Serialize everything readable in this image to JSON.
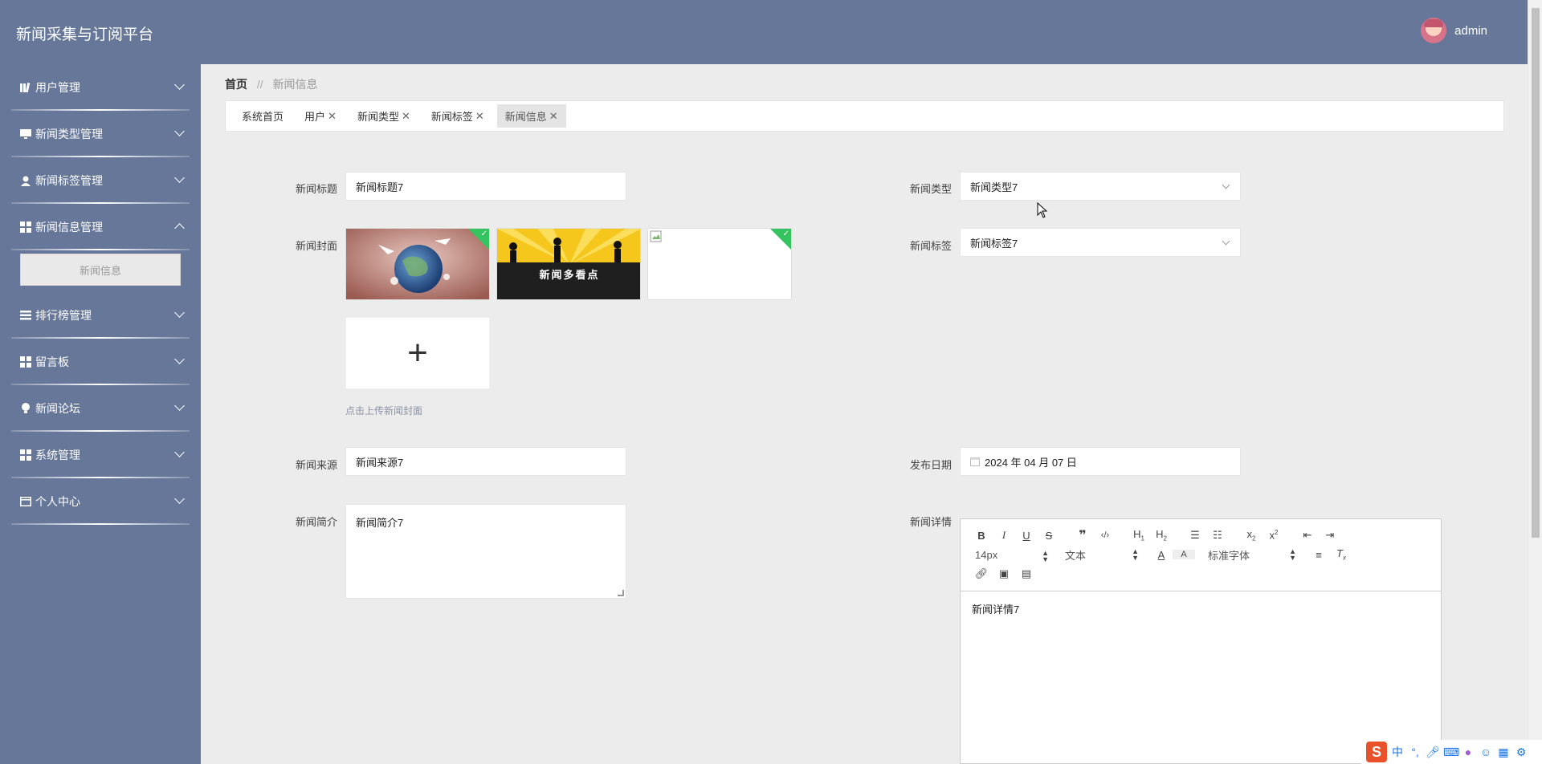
{
  "header": {
    "app_title": "新闻采集与订阅平台",
    "username": "admin"
  },
  "sidebar": {
    "items": [
      {
        "label": "用户管理",
        "icon": "book-icon"
      },
      {
        "label": "新闻类型管理",
        "icon": "monitor-icon"
      },
      {
        "label": "新闻标签管理",
        "icon": "user-icon"
      },
      {
        "label": "新闻信息管理",
        "icon": "grid-icon",
        "expanded": true
      },
      {
        "label": "排行榜管理",
        "icon": "list-icon"
      },
      {
        "label": "留言板",
        "icon": "grid-icon"
      },
      {
        "label": "新闻论坛",
        "icon": "bulb-icon"
      },
      {
        "label": "系统管理",
        "icon": "grid-icon"
      },
      {
        "label": "个人中心",
        "icon": "card-icon"
      }
    ],
    "submenu": {
      "label": "新闻信息"
    }
  },
  "breadcrumb": {
    "home": "首页",
    "sep": "//",
    "current": "新闻信息"
  },
  "tabs": [
    {
      "label": "系统首页",
      "closable": false
    },
    {
      "label": "用户",
      "closable": true
    },
    {
      "label": "新闻类型",
      "closable": true
    },
    {
      "label": "新闻标签",
      "closable": true
    },
    {
      "label": "新闻信息",
      "closable": true,
      "active": true
    }
  ],
  "form": {
    "title_label": "新闻标题",
    "title_value": "新闻标题7",
    "type_label": "新闻类型",
    "type_value": "新闻类型7",
    "cover_label": "新闻封面",
    "cover_hint": "点击上传新闻封面",
    "cover_banner_text": "新闻多看点",
    "tag_label": "新闻标签",
    "tag_value": "新闻标签7",
    "source_label": "新闻来源",
    "source_value": "新闻来源7",
    "date_label": "发布日期",
    "date_value": "2024 年 04 月 07 日",
    "summary_label": "新闻简介",
    "summary_value": "新闻简介7",
    "detail_label": "新闻详情",
    "detail_value": "新闻详情7"
  },
  "editor": {
    "font_size": "14px",
    "block_format": "文本",
    "font_family": "标准字体",
    "icons_row1": [
      "bold-icon",
      "italic-icon",
      "underline-icon",
      "strike-icon",
      "quote-icon",
      "code-icon",
      "h1-icon",
      "h2-icon",
      "ordered-list-icon",
      "bullet-list-icon",
      "subscript-icon",
      "superscript-icon",
      "outdent-icon",
      "indent-icon"
    ],
    "icons_row2": [
      "font-color-icon",
      "background-color-icon",
      "align-icon",
      "clear-format-icon"
    ],
    "icons_row3": [
      "link-icon",
      "image-icon",
      "video-icon"
    ]
  },
  "colors": {
    "header_bg": "#667799",
    "corner_green": "#34c35e"
  }
}
